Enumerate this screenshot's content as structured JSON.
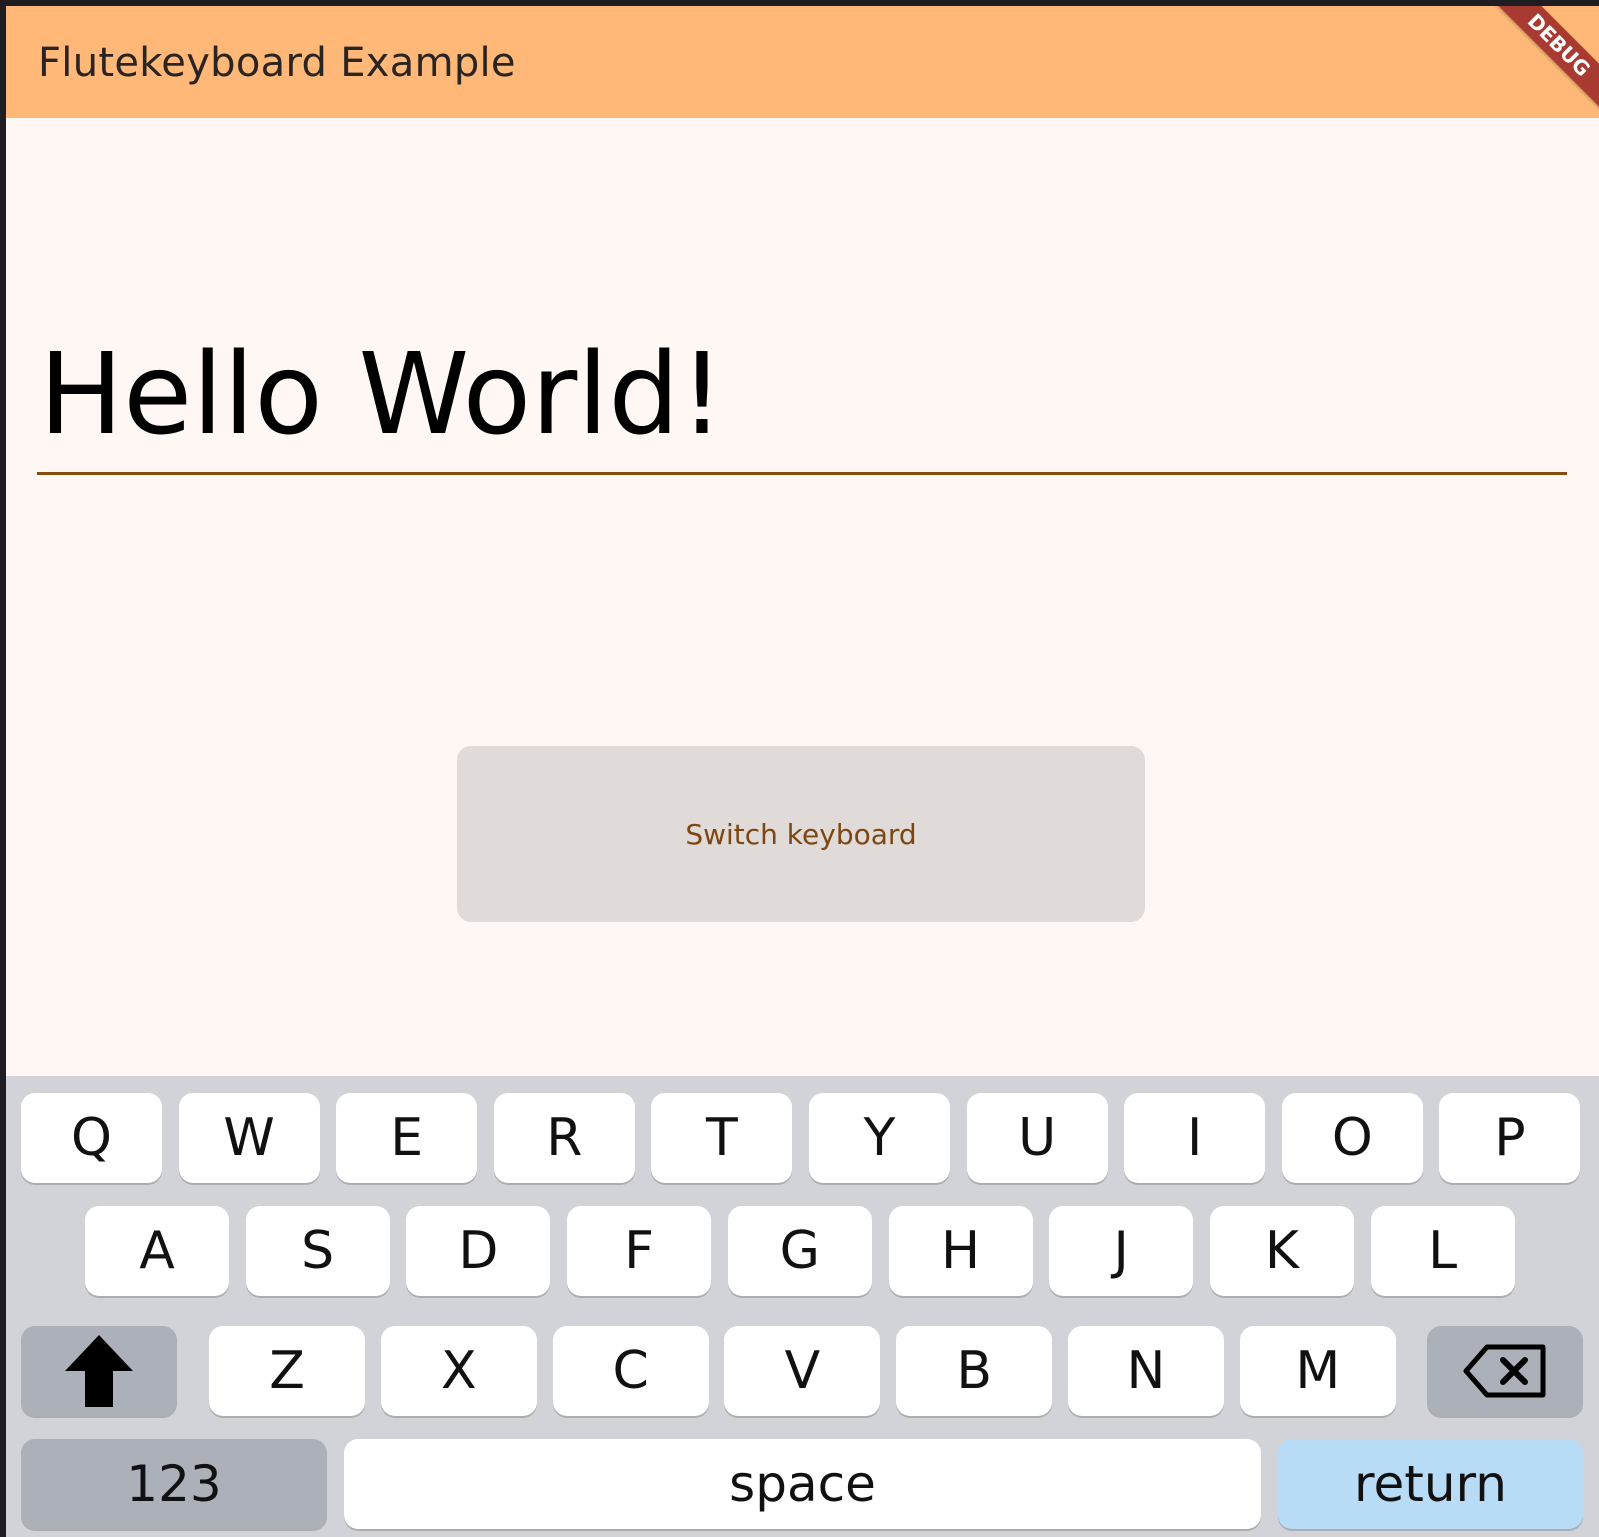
{
  "app": {
    "title": "Flutekeyboard Example",
    "debug_banner": "DEBUG"
  },
  "text_field": {
    "value": "Hello World!"
  },
  "switch_button": {
    "label": "Switch keyboard"
  },
  "keyboard": {
    "row1": [
      "Q",
      "W",
      "E",
      "R",
      "T",
      "Y",
      "U",
      "I",
      "O",
      "P"
    ],
    "row2": [
      "A",
      "S",
      "D",
      "F",
      "G",
      "H",
      "J",
      "K",
      "L"
    ],
    "row3": [
      "Z",
      "X",
      "C",
      "V",
      "B",
      "N",
      "M"
    ],
    "numbers_label": "123",
    "space_label": "space",
    "return_label": "return",
    "icons": {
      "shift": "shift-arrow-up-icon",
      "backspace": "backspace-icon"
    }
  }
}
